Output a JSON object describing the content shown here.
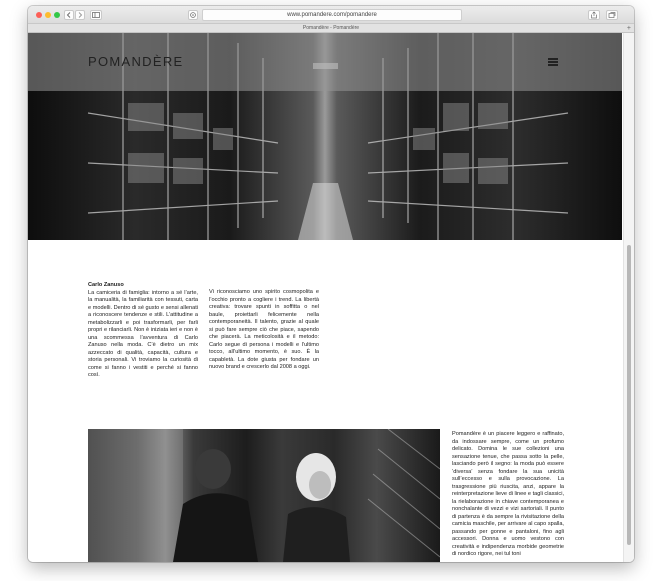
{
  "browser": {
    "url": "www.pomandere.com/pomandere",
    "tab_title": "Pomandère - Pomandère",
    "back_icon": "chevron-left-icon",
    "forward_icon": "chevron-right-icon",
    "sidebar_icon": "sidebar-icon",
    "privacy_icon": "privacy-icon",
    "share_icon": "share-icon",
    "tabs_icon": "tabs-icon",
    "new_tab_label": "+"
  },
  "header": {
    "logo": "POMANDÈRE",
    "menu_icon": "hamburger-menu-icon"
  },
  "sections": {
    "col1": {
      "title": "Carlo Zanuso",
      "body": "La camiceria di famiglia: intorno a sé l’arte, la manualità, la familiarità con tessuti, carta e modelli. Dentro di sé gusto e sensi allenati a riconoscere tendenze e stili. L’attitudine a metabolizzarli e poi trasformarli, per farli propri e rilanciarli. Non è iniziata ieri e non è una scommessa l’avventura di Carlo Zanuso nella moda. C’è dietro un mix azzeccato di qualità, capacità, cultura e storia personali. Vi troviamo la curiosità di come si fanno i vestiti e perché si fanno così."
    },
    "col2": {
      "body": "Vi riconosciamo uno spirito cosmopolita e l’occhio pronto a cogliere i trend. La libertà creativa: trovare spunti in soffitta o nel baule, proiettarli felicemente nella contemporaneità. Il talento, grazie al quale si può fare sempre ciò che piace, sapendo che piacerà. La meticolosità e il metodo: Carlo segue di persona i modelli e l’ultimo tocco, all’ultimo momento, è suo. È la capabletà. La dote giusta per fondare un nuovo brand e crescerlo dal 2008 a oggi."
    },
    "col3": {
      "body": "Pomandère è un piacere leggero e raffinato, da indossare sempre, come un profumo delicato. Domina le sue collezioni una sensazione tenue, che passa sotto la pelle, lasciando però il segno: la moda può essere ‘diversa’ senza fondare la sua unicità sull’eccesso e sulla provocazione. La trasgressione più riuscita, anzi, appare la reinterpretazione lieve di linee e tagli classici, la rielaborazione in chiave contemporanea e nonchalante di vezzi e vizi sartoriali. Il punto di partenza è da sempre la rivisitazione della camicia maschile, per arrivare al capo spalla, passando per gonne e pantaloni, fino agli accessori. Donna e uomo vestono con creatività e indipendenza morbide geometrie di nordico rigore, nei tul toni"
    }
  },
  "colors": {
    "traffic_red": "#fc5f57",
    "traffic_yellow": "#fdbc2e",
    "traffic_green": "#33c748"
  }
}
